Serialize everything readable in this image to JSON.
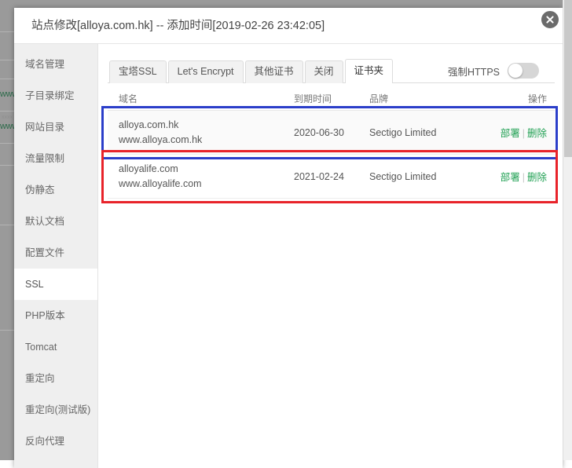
{
  "modal": {
    "title": "站点修改[alloya.com.hk] -- 添加时间[2019-02-26 23:42:05]",
    "close_icon": "close-icon"
  },
  "sidebar": {
    "items": [
      {
        "label": "域名管理",
        "active": false
      },
      {
        "label": "子目录绑定",
        "active": false
      },
      {
        "label": "网站目录",
        "active": false
      },
      {
        "label": "流量限制",
        "active": false
      },
      {
        "label": "伪静态",
        "active": false
      },
      {
        "label": "默认文档",
        "active": false
      },
      {
        "label": "配置文件",
        "active": false
      },
      {
        "label": "SSL",
        "active": true
      },
      {
        "label": "PHP版本",
        "active": false
      },
      {
        "label": "Tomcat",
        "active": false
      },
      {
        "label": "重定向",
        "active": false
      },
      {
        "label": "重定向(测试版)",
        "active": false
      },
      {
        "label": "反向代理",
        "active": false
      }
    ]
  },
  "tabs": [
    {
      "label": "宝塔SSL",
      "active": false
    },
    {
      "label": "Let's Encrypt",
      "active": false
    },
    {
      "label": "其他证书",
      "active": false
    },
    {
      "label": "关闭",
      "active": false
    },
    {
      "label": "证书夹",
      "active": true
    }
  ],
  "force_https": {
    "label": "强制HTTPS",
    "enabled": false
  },
  "cert_table": {
    "headers": {
      "domain": "域名",
      "expire": "到期时间",
      "brand": "品牌",
      "action": "操作"
    },
    "rows": [
      {
        "domains": [
          "alloya.com.hk",
          "www.alloya.com.hk"
        ],
        "expire": "2020-06-30",
        "brand": "Sectigo Limited",
        "deploy_label": "部署",
        "separator": "|",
        "delete_label": "删除",
        "highlight": "blue"
      },
      {
        "domains": [
          "alloyalife.com",
          "www.alloyalife.com"
        ],
        "expire": "2021-02-24",
        "brand": "Sectigo Limited",
        "deploy_label": "部署",
        "separator": "|",
        "delete_label": "删除",
        "highlight": "red"
      }
    ]
  },
  "annotations": {
    "blue_color": "#2b3ec9",
    "red_color": "#e8232a"
  },
  "background": {
    "link_text": "www",
    "backdrop_color": "#9a9a9a"
  },
  "colors": {
    "accent_green": "#20a053",
    "text": "#555555",
    "sidebar_bg": "#efefef"
  }
}
